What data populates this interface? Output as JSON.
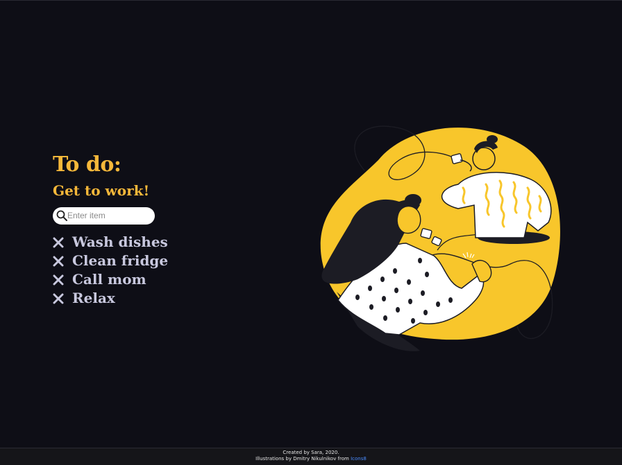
{
  "todo": {
    "title": "To do:",
    "subtitle": "Get to work!",
    "search_placeholder": "Enter item",
    "items": [
      {
        "label": "Wash dishes"
      },
      {
        "label": "Clean fridge"
      },
      {
        "label": "Call mom"
      },
      {
        "label": "Relax"
      }
    ]
  },
  "footer": {
    "line1": "Created by Sara, 2020.",
    "line2_prefix": "Illustrations by Dmitry Nikulnikov from",
    "link_text": "Icons8"
  },
  "icons": {
    "search": "search-icon",
    "delete": "close-icon"
  },
  "colors": {
    "background": "#0e0e16",
    "accent": "#f6b83a",
    "item_text": "#c8c8de",
    "illustration_yellow": "#f8c62b",
    "link": "#4a8cff"
  }
}
